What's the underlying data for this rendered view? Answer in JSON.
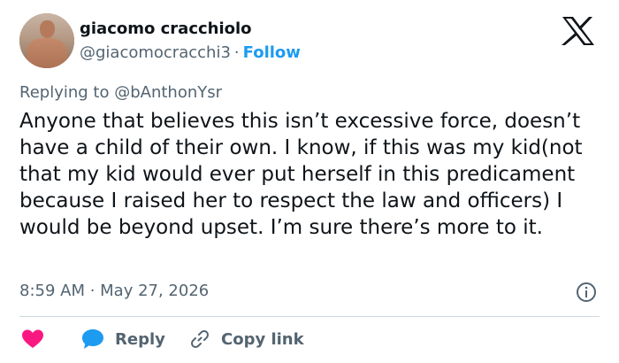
{
  "user": {
    "name": "giacomo cracchiolo",
    "handle": "@giacomocracchi3",
    "separator": "·",
    "follow_label": "Follow"
  },
  "tweet": {
    "replying_to": "Replying to @bAnthonYsr",
    "text": "Anyone that believes this isn’t excessive force, doesn’t have a child of their own. I know, if this was my kid(not that my kid would ever put herself in this predicament because I raised her to respect the law and officers) I would be beyond upset. I’m sure there’s more to it.",
    "timestamp": "8:59 AM · May 27, 2026"
  },
  "actions": {
    "reply_label": "Reply",
    "copy_link_label": "Copy link"
  },
  "icons": {
    "brand": "x-logo-icon",
    "info": "info-icon",
    "like": "heart-icon",
    "reply": "reply-bubble-icon",
    "link": "link-icon"
  },
  "colors": {
    "text": "#0f1419",
    "secondary": "#536471",
    "accent": "#1d9bf0",
    "like": "#f91880",
    "divider": "#cfd9de"
  }
}
